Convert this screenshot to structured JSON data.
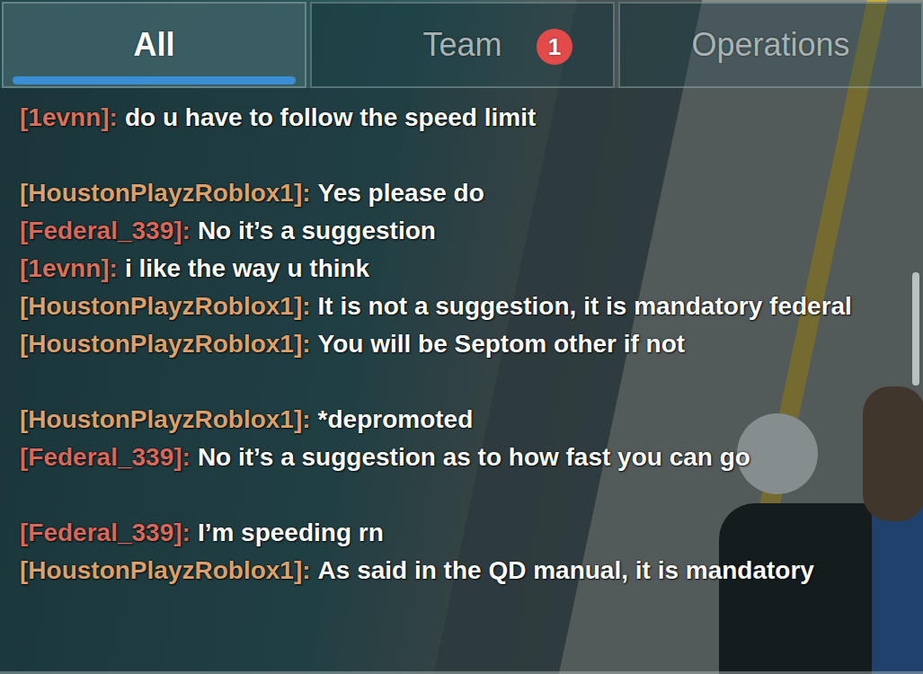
{
  "tabs": [
    {
      "label": "All",
      "selected": true,
      "badge": ""
    },
    {
      "label": "Team",
      "selected": false,
      "badge": "1"
    },
    {
      "label": "Operations",
      "selected": false,
      "badge": ""
    }
  ],
  "messages": [
    {
      "name": "[1evnn]:",
      "text": "do u have to follow the speed limit",
      "color": "#d9705a",
      "kind": "spaced"
    },
    {
      "name": "[HoustonPlayzRoblox1]:",
      "text": "Yes please do",
      "color": "#dba06c",
      "kind": "plain"
    },
    {
      "name": "[Federal_339]:",
      "text": "No it’s a suggestion",
      "color": "#d9675a",
      "kind": "plain"
    },
    {
      "name": "[1evnn]:",
      "text": "i like the way u think",
      "color": "#d9705a",
      "kind": "plain"
    },
    {
      "name": "[HoustonPlayzRoblox1]:",
      "text": "It is not a suggestion, it is mandatory federal",
      "color": "#dba06c",
      "kind": "plain"
    },
    {
      "name": "[HoustonPlayzRoblox1]:",
      "text": "You will be Septom other if not",
      "color": "#dba06c",
      "kind": "spaced"
    },
    {
      "name": "[HoustonPlayzRoblox1]:",
      "text": "*depromoted",
      "color": "#dba06c",
      "kind": "plain"
    },
    {
      "name": "[Federal_339]:",
      "text": "No it’s a suggestion as to how fast you can go",
      "color": "#d9675a",
      "kind": "spaced"
    },
    {
      "name": "[Federal_339]:",
      "text": "I’m speeding rn",
      "color": "#d9675a",
      "kind": "plain"
    },
    {
      "name": "[HoustonPlayzRoblox1]:",
      "text": "As said in the QD manual, it is mandatory",
      "color": "#dba06c",
      "kind": "plain"
    }
  ]
}
